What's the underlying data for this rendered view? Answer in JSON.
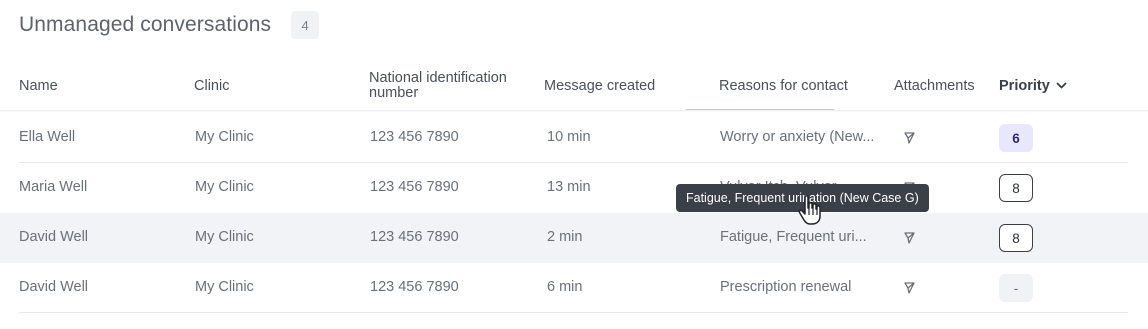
{
  "header": {
    "title": "Unmanaged conversations",
    "count": "4"
  },
  "columns": {
    "name": "Name",
    "clinic": "Clinic",
    "national_id_line1": "National identification",
    "national_id_line2": "number",
    "message_created": "Message created",
    "reasons": "Reasons for contact",
    "attachments": "Attachments",
    "priority": "Priority"
  },
  "rows": [
    {
      "name": "Ella Well",
      "clinic": "My Clinic",
      "national_id": "123 456 7890",
      "message_created": "10 min",
      "reason": "Worry or anxiety (New...",
      "priority": "6",
      "priority_style": "filled"
    },
    {
      "name": "Maria Well",
      "clinic": "My Clinic",
      "national_id": "123 456 7890",
      "message_created": "13 min",
      "reason": "Vulvar Itch, Vulvar...",
      "priority": "8",
      "priority_style": "outline"
    },
    {
      "name": "David Well",
      "clinic": "My Clinic",
      "national_id": "123 456 7890",
      "message_created": "2 min",
      "reason": "Fatigue, Frequent uri...",
      "priority": "8",
      "priority_style": "outline"
    },
    {
      "name": "David Well",
      "clinic": "My Clinic",
      "national_id": "123 456 7890",
      "message_created": "6 min",
      "reason": "Prescription renewal",
      "priority": "-",
      "priority_style": "none"
    }
  ],
  "tooltip": "Fatigue, Frequent urination (New Case G)",
  "colors": {
    "accent": "#e9e7fb",
    "hover_row": "#f2f3f6",
    "tooltip_bg": "#3a3f48"
  },
  "icons": {
    "attachment": "paperclip-icon",
    "sort": "chevron-down-icon",
    "cursor": "hand-pointer-icon"
  }
}
